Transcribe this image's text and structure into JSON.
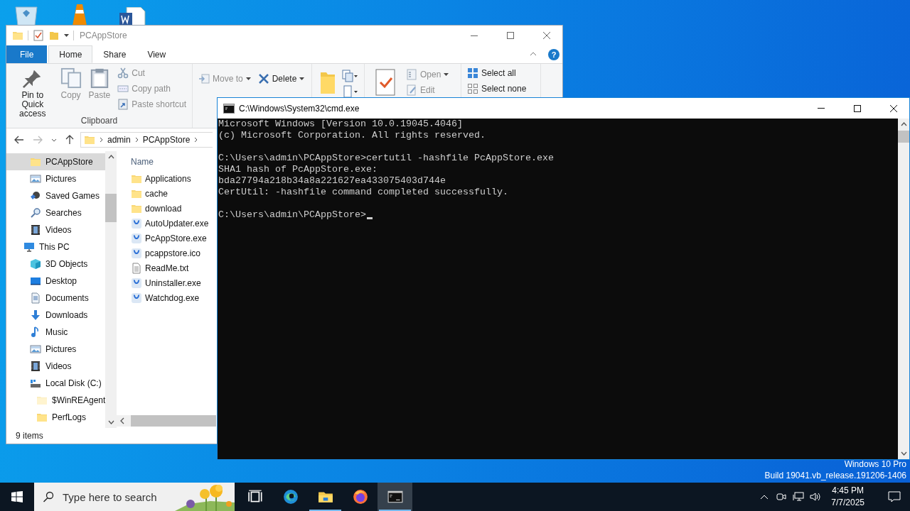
{
  "desktop": {
    "edition": "Windows 10 Pro",
    "build": "Build 19041.vb_release.191206-1406"
  },
  "explorer": {
    "title": "PCAppStore",
    "ribbon_tabs": [
      {
        "label": "File",
        "kind": "file",
        "selected": false
      },
      {
        "label": "Home",
        "kind": "tab",
        "selected": true
      },
      {
        "label": "Share",
        "kind": "tab",
        "selected": false
      },
      {
        "label": "View",
        "kind": "tab",
        "selected": false
      }
    ],
    "help": "?",
    "clipboard": {
      "large_buttons": [
        {
          "label": "Pin to Quick access",
          "kind": "pin",
          "disabled": false
        },
        {
          "label": "Copy",
          "kind": "copy",
          "disabled": true
        },
        {
          "label": "Paste",
          "kind": "paste",
          "disabled": true
        }
      ],
      "small_buttons": [
        {
          "label": "Cut",
          "kind": "cut",
          "disabled": true
        },
        {
          "label": "Copy path",
          "kind": "copypath",
          "disabled": true
        },
        {
          "label": "Paste shortcut",
          "kind": "shortcut",
          "disabled": true
        }
      ],
      "group_label": "Clipboard"
    },
    "organize": [
      {
        "label": "Move to",
        "kind": "move",
        "disabled": true,
        "dropdown": true
      },
      {
        "label": "Delete",
        "kind": "delete",
        "disabled": false,
        "dropdown": true
      }
    ],
    "open": [
      {
        "label": "Open",
        "kind": "open",
        "disabled": true,
        "dropdown": true
      },
      {
        "label": "Edit",
        "kind": "edit",
        "disabled": true,
        "dropdown": false
      }
    ],
    "select": [
      {
        "label": "Select all",
        "kind": "selectall"
      },
      {
        "label": "Select none",
        "kind": "selectnone"
      }
    ],
    "breadcrumb": [
      "admin",
      "PCAppStore"
    ],
    "quick_access": [
      {
        "label": "PCAppStore",
        "kind": "folder",
        "selected": true
      },
      {
        "label": "Pictures",
        "kind": "pictures",
        "selected": false
      },
      {
        "label": "Saved Games",
        "kind": "games",
        "selected": false
      },
      {
        "label": "Searches",
        "kind": "search",
        "selected": false
      },
      {
        "label": "Videos",
        "kind": "videos",
        "selected": false
      }
    ],
    "tree": [
      {
        "label": "This PC",
        "kind": "pc",
        "selected": false,
        "children": [
          {
            "label": "3D Objects",
            "kind": "cube",
            "selected": false
          },
          {
            "label": "Desktop",
            "kind": "desktop",
            "selected": false
          },
          {
            "label": "Documents",
            "kind": "documents",
            "selected": false
          },
          {
            "label": "Downloads",
            "kind": "downloads",
            "selected": false
          },
          {
            "label": "Music",
            "kind": "music",
            "selected": false
          },
          {
            "label": "Pictures",
            "kind": "pictures",
            "selected": false
          },
          {
            "label": "Videos",
            "kind": "videos",
            "selected": false
          },
          {
            "label": "Local Disk (C:)",
            "kind": "disk",
            "selected": false,
            "children": [
              {
                "label": "$WinREAgent",
                "kind": "folder_faded",
                "selected": false
              },
              {
                "label": "PerfLogs",
                "kind": "folder",
                "selected": false
              }
            ]
          }
        ]
      }
    ],
    "column_header": "Name",
    "files": [
      {
        "name": "Applications",
        "kind": "folder"
      },
      {
        "name": "cache",
        "kind": "folder"
      },
      {
        "name": "download",
        "kind": "folder"
      },
      {
        "name": "AutoUpdater.exe",
        "kind": "app"
      },
      {
        "name": "PcAppStore.exe",
        "kind": "app"
      },
      {
        "name": "pcappstore.ico",
        "kind": "app"
      },
      {
        "name": "ReadMe.txt",
        "kind": "text"
      },
      {
        "name": "Uninstaller.exe",
        "kind": "app"
      },
      {
        "name": "Watchdog.exe",
        "kind": "app"
      }
    ],
    "status": "9 items"
  },
  "cmd": {
    "title": "C:\\Windows\\System32\\cmd.exe",
    "blocks": [
      [
        "Microsoft Windows [Version 10.0.19045.4046]",
        "(c) Microsoft Corporation. All rights reserved."
      ],
      [
        "C:\\Users\\admin\\PCAppStore>certutil -hashfile PcAppStore.exe",
        "SHA1 hash of PcAppStore.exe:",
        "bda27794a218b34a8a221627ea433075403d744e",
        "CertUtil: -hashfile command completed successfully."
      ],
      [
        "C:\\Users\\admin\\PCAppStore>"
      ]
    ]
  },
  "taskbar": {
    "search_placeholder": "Type here to search",
    "apps": [
      {
        "kind": "taskview",
        "running": false,
        "selected": false
      },
      {
        "kind": "edge",
        "running": false,
        "selected": false
      },
      {
        "kind": "explorer",
        "running": true,
        "selected": false
      },
      {
        "kind": "firefox",
        "running": false,
        "selected": false
      },
      {
        "kind": "cmd",
        "running": true,
        "selected": true
      }
    ],
    "time": "4:45 PM",
    "date": "7/7/2025"
  }
}
